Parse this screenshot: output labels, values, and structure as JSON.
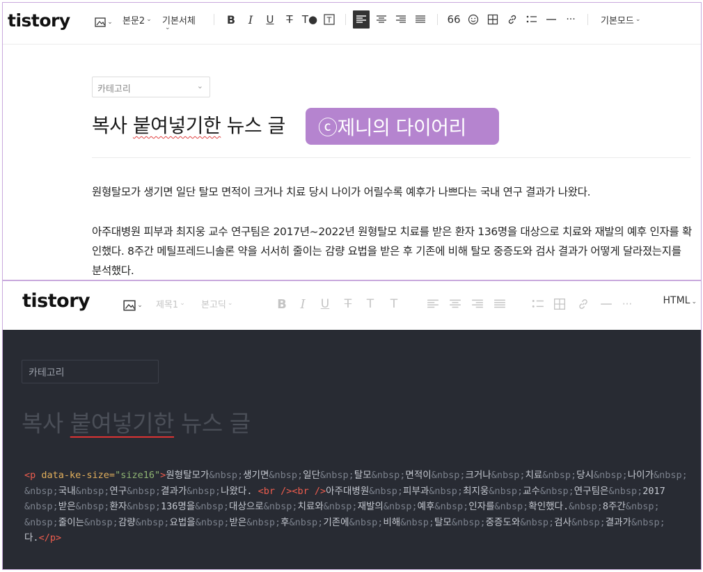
{
  "top": {
    "logo": "tistory",
    "toolbar": {
      "paragraph_style": "본문2",
      "font": "기본서체",
      "quote_label": "66",
      "mode": "기본모드"
    },
    "category_placeholder": "카테고리",
    "title_parts": [
      "복사 ",
      "붙여넣기한",
      " 뉴스 글"
    ],
    "watermark": "ⓒ제니의 다이어리",
    "paragraphs": [
      "원형탈모가 생기면 일단 탈모 면적이 크거나 치료 당시 나이가 어릴수록 예후가 나쁘다는 국내 연구 결과가 나왔다.",
      "아주대병원 피부과 최지웅 교수 연구팀은 2017년~2022년 원형탈모 치료를 받은 환자 136명을 대상으로 치료와 재발의 예후 인자를 확인했다. 8주간 메틸프레드니솔론 약을 서서히 줄이는 감량 요법을 받은 후 기존에 비해 탈모 중증도와 검사 결과가 어떻게 달라졌는지를 분석했다."
    ]
  },
  "bottom": {
    "logo": "tistory",
    "toolbar": {
      "heading": "제목1",
      "font": "본고딕",
      "mode": "HTML"
    },
    "category_placeholder": "카테고리",
    "title_parts": [
      "복사 ",
      "붙여넣기한",
      " 뉴스 글"
    ],
    "code": {
      "tag_open": "<p ",
      "attr_name": "data-ke-size=",
      "attr_value": "\"size16\"",
      "tag_close": ">",
      "lines": [
        "원형탈모가&nbsp;생기면&nbsp;일단&nbsp;탈모&nbsp;면적이&nbsp;크거나&nbsp;치료&nbsp;당시&nbsp;나이가&nbsp;",
        "&nbsp;국내&nbsp;연구&nbsp;결과가&nbsp;나왔다. ",
        "아주대병원&nbsp;피부과&nbsp;최지웅&nbsp;교수&nbsp;연구팀은&nbsp;2017",
        "&nbsp;받은&nbsp;환자&nbsp;136명을&nbsp;대상으로&nbsp;치료와&nbsp;재발의&nbsp;예후&nbsp;인자를&nbsp;확인했다.&nbsp;8주간&nbsp;",
        "&nbsp;줄이는&nbsp;감량&nbsp;요법을&nbsp;받은&nbsp;후&nbsp;기존에&nbsp;비해&nbsp;탈모&nbsp;중증도와&nbsp;검사&nbsp;결과가&nbsp;",
        "다."
      ],
      "br_tags": "<br /><br />",
      "end_tag": "</p>"
    }
  }
}
